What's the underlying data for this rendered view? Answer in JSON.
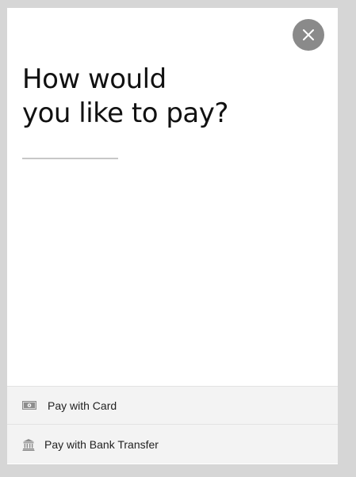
{
  "modal": {
    "title_line1": "How would",
    "title_line2": "you like to pay?",
    "close_icon": "close-icon"
  },
  "options": [
    {
      "label": "Pay with Card",
      "icon": "banknote-icon"
    },
    {
      "label": "Pay with Bank Transfer",
      "icon": "bank-icon"
    }
  ],
  "colors": {
    "backdrop": "#d6d6d6",
    "close_button": "#8a8a8a",
    "option_background": "#f3f3f3",
    "text": "#111111"
  }
}
